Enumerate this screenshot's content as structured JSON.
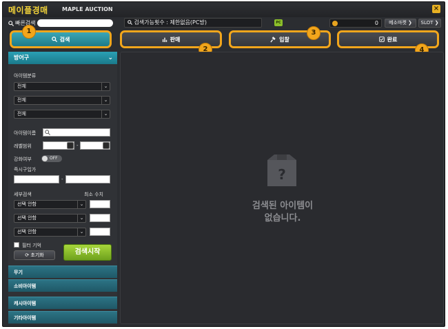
{
  "window": {
    "title_ko": "메이플경매",
    "title_en": "MAPLE AUCTION",
    "close": "×"
  },
  "infobar": {
    "search_label": "빠른검색",
    "search_count": "검색가능횟수 : 제한없음(PC방)",
    "pc_badge": "PC",
    "meso_value": "0",
    "meso_market": "메소마켓 ❯",
    "slot": "SLOT ❯"
  },
  "tabs": [
    {
      "label": "검색",
      "icon": "search-icon",
      "badge": "1",
      "active": true
    },
    {
      "label": "판매",
      "icon": "bar-chart-icon",
      "badge": "2",
      "active": false
    },
    {
      "label": "입찰",
      "icon": "hammer-icon",
      "badge": "3",
      "active": false
    },
    {
      "label": "완료",
      "icon": "check-icon",
      "badge": "4",
      "active": false
    }
  ],
  "sidebar": {
    "section": "방어구",
    "item_category_label": "아이템분류",
    "category_dropdowns": [
      "전체",
      "전체",
      "전체"
    ],
    "item_name_label": "아이템이름",
    "level_range_label": "레벨범위",
    "level_sep": "-",
    "enhance_label": "강화여부",
    "enhance_toggle": "OFF",
    "buyout_label": "즉시구입가",
    "buyout_sep": "-",
    "detail_label": "세부검색",
    "min_value_label": "최소 수치",
    "detail_dropdowns": [
      "선택 안함",
      "선택 안함",
      "선택 안함"
    ],
    "filter_memory": "필터 기억",
    "reset": "초기화",
    "start": "검색시작",
    "categories": [
      "무기",
      "소비아이템",
      "캐시아이템",
      "기타아이템"
    ]
  },
  "main": {
    "empty_line1": "검색된 아이템이",
    "empty_line2": "없습니다."
  }
}
